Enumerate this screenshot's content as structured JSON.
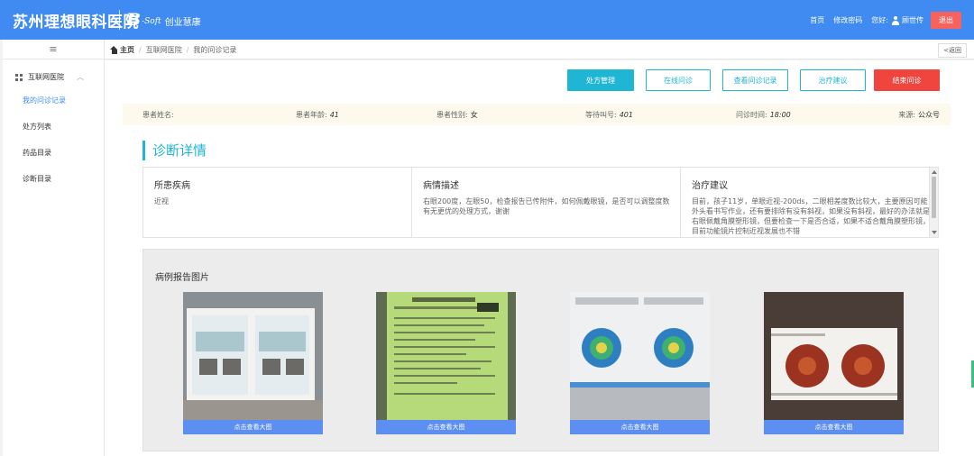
{
  "header": {
    "hospital_name": "苏州理想眼科医院",
    "logo_text": "B",
    "logo_soft": "-Soft",
    "logo_cn": "创业慧康",
    "nav": {
      "home": "首页",
      "change_password": "修改密码",
      "greeting": "您好:",
      "username": "顾世传",
      "logout": "退出"
    },
    "colors": {
      "bar": "#3f8bf2",
      "logout": "#f6635f"
    }
  },
  "sidebar": {
    "toggle": "≡",
    "group_label": "互联网医院",
    "items": [
      {
        "label": "我的问诊记录",
        "active": true
      },
      {
        "label": "处方列表",
        "active": false
      },
      {
        "label": "药品目录",
        "active": false
      },
      {
        "label": "诊断目录",
        "active": false
      }
    ]
  },
  "breadcrumb": {
    "home": "主页",
    "level1": "互联网医院",
    "level2": "我的问诊记录",
    "back": "<返回"
  },
  "actions": {
    "prescription_mgmt": "处方管理",
    "online_consult": "在线问诊",
    "view_records": "查看问诊记录",
    "treatment_advice": "治疗建议",
    "end_consult": "结束问诊",
    "colors": {
      "accent": "#1fb5d4",
      "danger": "#f0443e"
    }
  },
  "patient": {
    "name_label": "患者姓名:",
    "name_value": "",
    "age_label": "患者年龄:",
    "age_value": "41",
    "gender_label": "患者性别:",
    "gender_value": "女",
    "queue_label": "等待叫号:",
    "queue_value": "401",
    "time_label": "问诊时间:",
    "time_value": "18:00",
    "source_label": "来源:",
    "source_value": "公众号"
  },
  "diagnosis": {
    "section_title": "诊断详情",
    "disease": {
      "heading": "所患疾病",
      "text": "近视"
    },
    "description": {
      "heading": "病情描述",
      "text": "右眼200度，左眼50，检查报告已传附件，如何佩戴眼镜，是否可以调整度数 有无更优的处理方式，谢谢"
    },
    "advice": {
      "heading": "治疗建议",
      "text": "目前，孩子11岁，单眼近视-200ds，二眼相差度数比较大，主要原因可能外头看书写作业，还有要排除有没有斜视，如果没有斜视，最好的办法就是右眼佩戴角膜塑形镜，但要检查一下是否合适，如果不适合戴角膜塑形镜，目前功能镜片控制近视发展也不错"
    }
  },
  "reports": {
    "title": "病例报告图片",
    "cards": [
      {
        "caption": "点击查看大图"
      },
      {
        "caption": "点击查看大图"
      },
      {
        "caption": "点击查看大图"
      },
      {
        "caption": "点击查看大图"
      }
    ]
  }
}
